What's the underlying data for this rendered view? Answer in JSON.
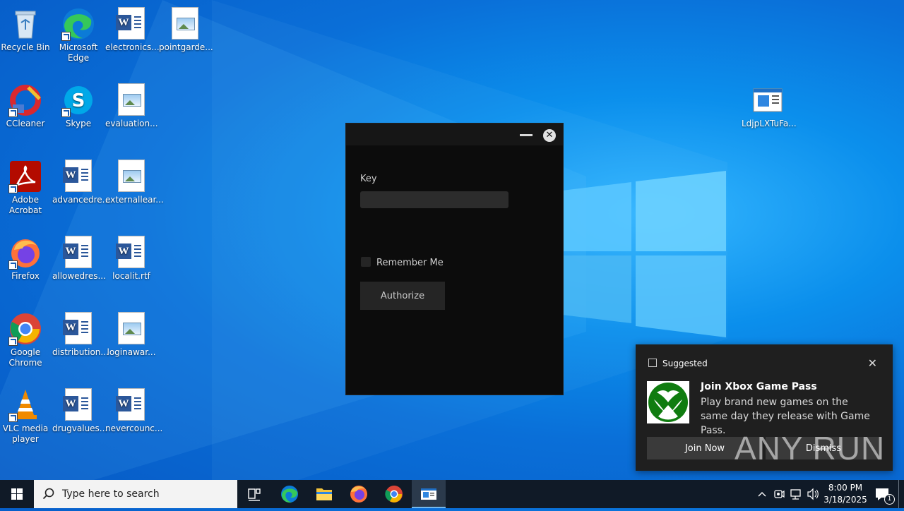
{
  "desktop_icons": [
    {
      "label": "Recycle Bin"
    },
    {
      "label": "Microsoft Edge"
    },
    {
      "label": "electronics..."
    },
    {
      "label": "pointgarde..."
    },
    {
      "label": "CCleaner"
    },
    {
      "label": "Skype"
    },
    {
      "label": "evaluation..."
    },
    {
      "label": "Adobe Acrobat"
    },
    {
      "label": "advancedre..."
    },
    {
      "label": "externallear..."
    },
    {
      "label": "Firefox"
    },
    {
      "label": "allowedres..."
    },
    {
      "label": "localit.rtf"
    },
    {
      "label": "Google Chrome"
    },
    {
      "label": "distribution..."
    },
    {
      "label": "loginawar..."
    },
    {
      "label": "VLC media player"
    },
    {
      "label": "drugvalues..."
    },
    {
      "label": "nevercounc..."
    },
    {
      "label": "LdjpLXTuFa..."
    }
  ],
  "app_window": {
    "key_label": "Key",
    "key_value": "",
    "remember_label": "Remember Me",
    "authorize_label": "Authorize"
  },
  "toast": {
    "header": "Suggested",
    "title": "Join Xbox Game Pass",
    "body": "Play brand new games on the same day they release with Game Pass.",
    "join_label": "Join Now",
    "dismiss_label": "Dismiss"
  },
  "watermark": "ANY RUN",
  "taskbar": {
    "search_placeholder": "Type here to search",
    "time": "8:00 PM",
    "date": "3/18/2025",
    "notification_count": "1"
  },
  "colors": {
    "desktop_blue": "#0a6fd8",
    "taskbar": "#101a27",
    "app_window_bg": "#0c0c0c",
    "toast_bg": "#1f1f1f",
    "xbox_green": "#107c10"
  }
}
